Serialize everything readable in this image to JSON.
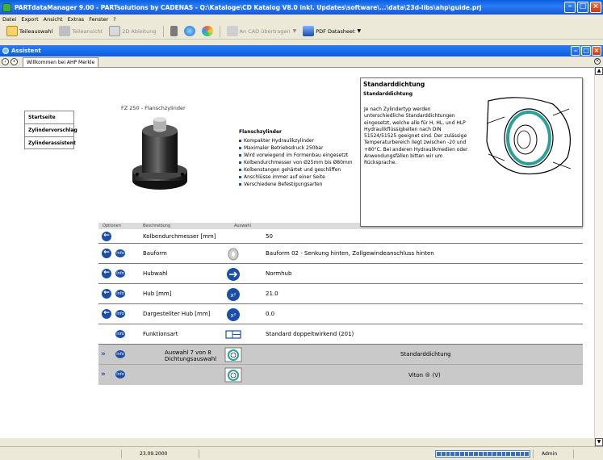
{
  "window": {
    "title": "PARTdataManager 9.00 - PARTsolutions by CADENAS - Q:\\Kataloge\\CD Katalog V8.0 inkl. Updates\\software\\...\\data\\23d-libs\\ahp\\guide.prj"
  },
  "menu": [
    "Datei",
    "Export",
    "Ansicht",
    "Extras",
    "Fenster",
    "?"
  ],
  "toolbar": {
    "teileauswahl": "Teileauswahl",
    "teileansicht": "Teileansicht",
    "ableitung": "2D Ableitung",
    "cad": "An CAD übertragen",
    "pdf": "PDF Datasheet"
  },
  "assistant": {
    "title": "Assistent",
    "tab": "Willkommen bei AHP Merkle"
  },
  "leftnav": [
    "Startseite",
    "Zylindervorschlag",
    "Zylinderassistent"
  ],
  "product": {
    "title": "FZ 250 - Flanschzylinder",
    "spec_heading": "Flanschzylinder",
    "specs": [
      "Kompakter Hydraulikzylinder",
      "Maximaler Betriebsdruck 250bar",
      "Wird vorwiegend im Formenbau eingesetzt",
      "Kolbendurchmesser von Ø25mm bis Ø80mm",
      "Kolbenstangen gehärtet und geschliffen",
      "Anschlüsse immer auf einer Seite",
      "Verschiedene Befestigungsarten"
    ]
  },
  "popup": {
    "title": "Standarddichtung",
    "subtitle": "Standarddichtung",
    "body": "Je nach Zylindertyp werden unterschiedliche Standarddichtungen eingesetzt, welche alle für H, HL, und HLP Hydraulikflüssigkeiten nach DIN 51524/51525 geeignet sind. Der zulässige Temperaturbereich liegt zwischen -20 und +80°C. Bei anderen Hydraulikmedien oder Anwendungsfällen bitten wir um Rücksprache."
  },
  "table": {
    "headers": {
      "optionen": "Optionen",
      "beschreibung": "Beschreibung",
      "auswahl": "Auswahl"
    },
    "rows": [
      {
        "label": "Kolbendurchmesser [mm]",
        "value": "50"
      },
      {
        "label": "Bauform",
        "value": "Bauform 02 - Senkung hinten, Zollgewindeanschluss hinten"
      },
      {
        "label": "Hubwahl",
        "value": "Normhub"
      },
      {
        "label": "Hub [mm]",
        "value": "21.0"
      },
      {
        "label": "Dargestellter Hub [mm]",
        "value": "0.0"
      },
      {
        "label": "Funktionsart",
        "value": "Standard doppeltwirkend (201)"
      }
    ],
    "selection": {
      "label_1": "Auswahl 7 von 8",
      "label_2": "Dichtungsauswahl",
      "option_1": "Standarddichtung",
      "option_2": "Viton ® (V)"
    },
    "info_label": "info"
  },
  "status": {
    "date": "23.09.2000",
    "user": "Admin"
  },
  "colors": {
    "accent": "#1a4ea8",
    "titlebar": "#0a5fe0",
    "seal": "#2aa198"
  }
}
